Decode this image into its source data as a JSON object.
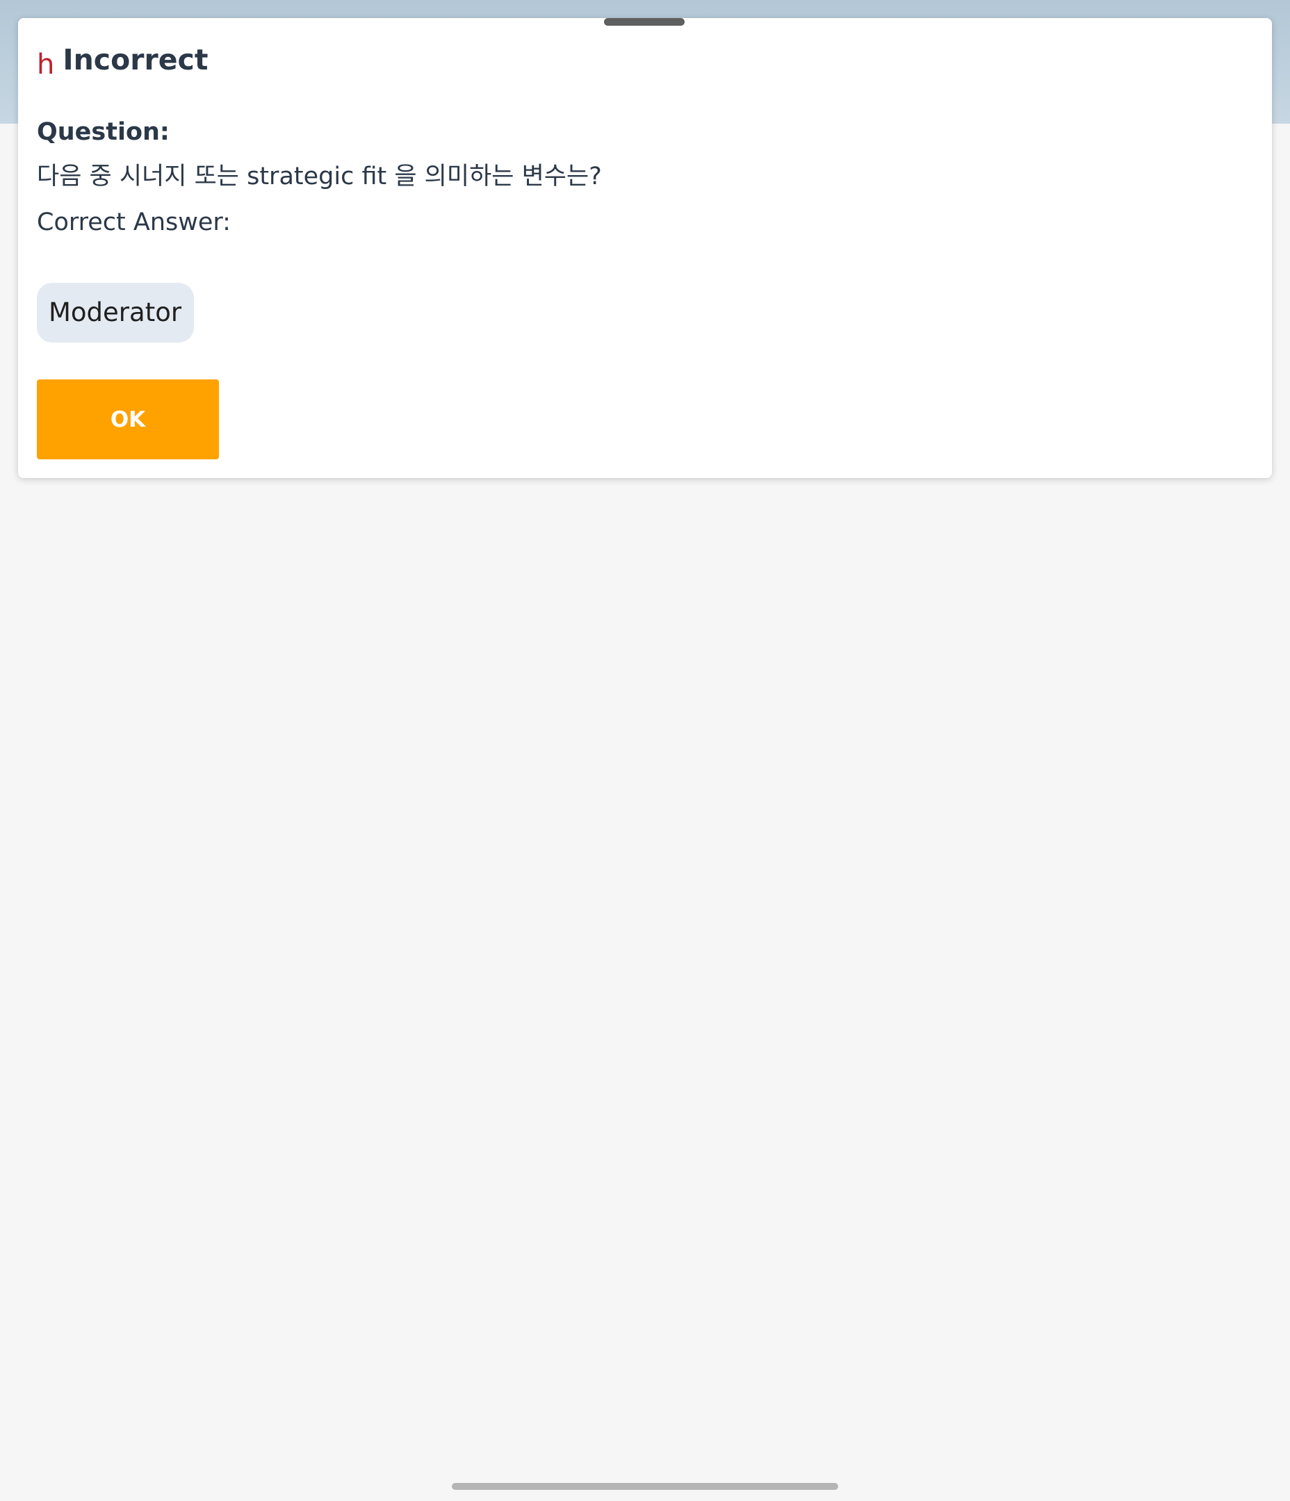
{
  "dialog": {
    "title_icon_glyph": "h",
    "title": "Incorrect",
    "question_label": "Question:",
    "question_text": "다음 중 시너지 또는 strategic fit 을 의미하는 변수는?",
    "correct_answer_label": "Correct Answer:",
    "correct_answer_value": "Moderator",
    "ok_button_label": "OK"
  },
  "colors": {
    "accent": "#ffa200",
    "error_icon": "#c0212b",
    "text": "#2b3848",
    "answer_chip_bg": "#e3eaf2",
    "page_bg": "#f6f6f6"
  }
}
